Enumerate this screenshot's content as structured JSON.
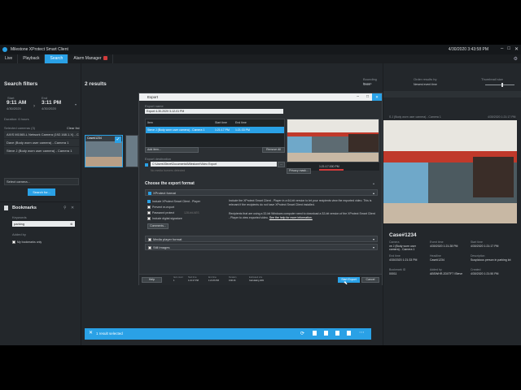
{
  "window": {
    "title": "Milestone XProtect Smart Client",
    "datetime": "4/30/2020 3:43:58 PM"
  },
  "tabs": [
    {
      "label": "Live"
    },
    {
      "label": "Playback"
    },
    {
      "label": "Search"
    },
    {
      "label": "Alarm Manager"
    }
  ],
  "filters": {
    "heading": "Search filters",
    "start_label": "Start",
    "end_label": "End",
    "start_time": "9:11 AM",
    "start_date": "4/30/2020",
    "end_time": "3:11 PM",
    "end_date": "4/30/2020",
    "duration": "Duration: 6 hours",
    "selected_cameras_label": "Selected cameras (3)",
    "clear_list": "Clear list",
    "cameras": [
      "AXIS M1065-L Network Camera (192.168.1.X) - Ca...",
      "Dave (Body worn user camera) - Camera 1",
      "Steve J (Body worn user camera) - Camera 1"
    ],
    "select_camera": "Select camera...",
    "search_button": "Search for..."
  },
  "bookmarks": {
    "heading": "Bookmarks",
    "keywords_label": "Keywords",
    "keyword_value": "parking",
    "added_by_label": "Added by",
    "my_bookmarks": "My bookmarks only"
  },
  "results": {
    "count": "2 results",
    "thumb_case": "Case#1234",
    "sort_label": "Bounding boxes",
    "sort_value": "Show",
    "order_label": "Order results by",
    "order_value": "Newest event time",
    "preview_label": "Thumbnail size"
  },
  "dialog": {
    "title": "Export",
    "export_name_label": "Export name",
    "export_name_value": "Export 4-30-2020 3-12-01 PM",
    "columns": [
      "Item",
      "Start time",
      "End time"
    ],
    "item": "Steve J (Body worn user camera) - Camera 1",
    "item_start": "1:21:17 PM",
    "item_end": "1:21:33 PM",
    "add_item": "Add item...",
    "remove_all": "Remove All",
    "destination_label": "Export destination",
    "destination_path": "C:\\Users\\Steve\\Documents\\Milestone\\Video Export",
    "media_burn": "No media burners detected",
    "privacy_mask": "Privacy mask...",
    "choose_format": "Choose the export format",
    "format_xprotect": "XProtect format",
    "include_player": "Include XProtect Smart Client - Player",
    "prevent_reexport": "Prevent re-export",
    "password_protect": "Password protect",
    "password_placeholder": "128-bit AES",
    "include_signature": "Include digital signature",
    "comments_button": "Comments...",
    "player_note_1": "Include the XProtect Smart Client - Player in a 64-bit version to let your recipients view the exported video. This is relevant if the recipients do not have XProtect Smart Client installed.",
    "player_note_2": "Recipients that are using a 32-bit Windows computer need to download a 32-bit version of the XProtect Smart Client - Player to view exported video. ",
    "player_link": "See the help for more information.",
    "media_format": "Media player format",
    "still_images": "Still images",
    "help_button": "Help",
    "item_count_label": "Item count",
    "item_count": "1",
    "start_time_label": "Start time",
    "start_time": "1:21:17 PM",
    "end_time_label": "End time",
    "end_time": "1:21:33 PM",
    "duration_label": "Duration",
    "duration": "0:00:16",
    "size_label": "Estimated size",
    "size": "Calculating 40%",
    "timeline_time": "1:21:17.000 PM",
    "start_export": "Start Export",
    "cancel": "Cancel"
  },
  "details": {
    "camera_label": "S J (Body worn user camera) - Camera 1",
    "camera_time": "4/30/2020 1:21:17 PM",
    "case_title": "Case#1234",
    "fields": [
      {
        "label": "Camera",
        "value": "ve J (Body worn user camera) - Camera 1"
      },
      {
        "label": "Event time",
        "value": "4/30/2020 1:21:28 PM"
      },
      {
        "label": "Start time",
        "value": "4/30/2020 1:21:17 PM"
      },
      {
        "label": "End time",
        "value": "4/30/2020 1:21:33 PM"
      },
      {
        "label": "Headline",
        "value": "Case#1234"
      },
      {
        "label": "Description",
        "value": "Suspicious person in parking lot"
      },
      {
        "label": "Created",
        "value": "4/30/2020 1:21:50 PM"
      },
      {
        "label": "Added by",
        "value": "ABSWHR-2D0TF7 \\Steve"
      }
    ],
    "id_label": "Bookmark ID",
    "id_value": "00011"
  },
  "bottom": {
    "selected": "1 result selected"
  }
}
